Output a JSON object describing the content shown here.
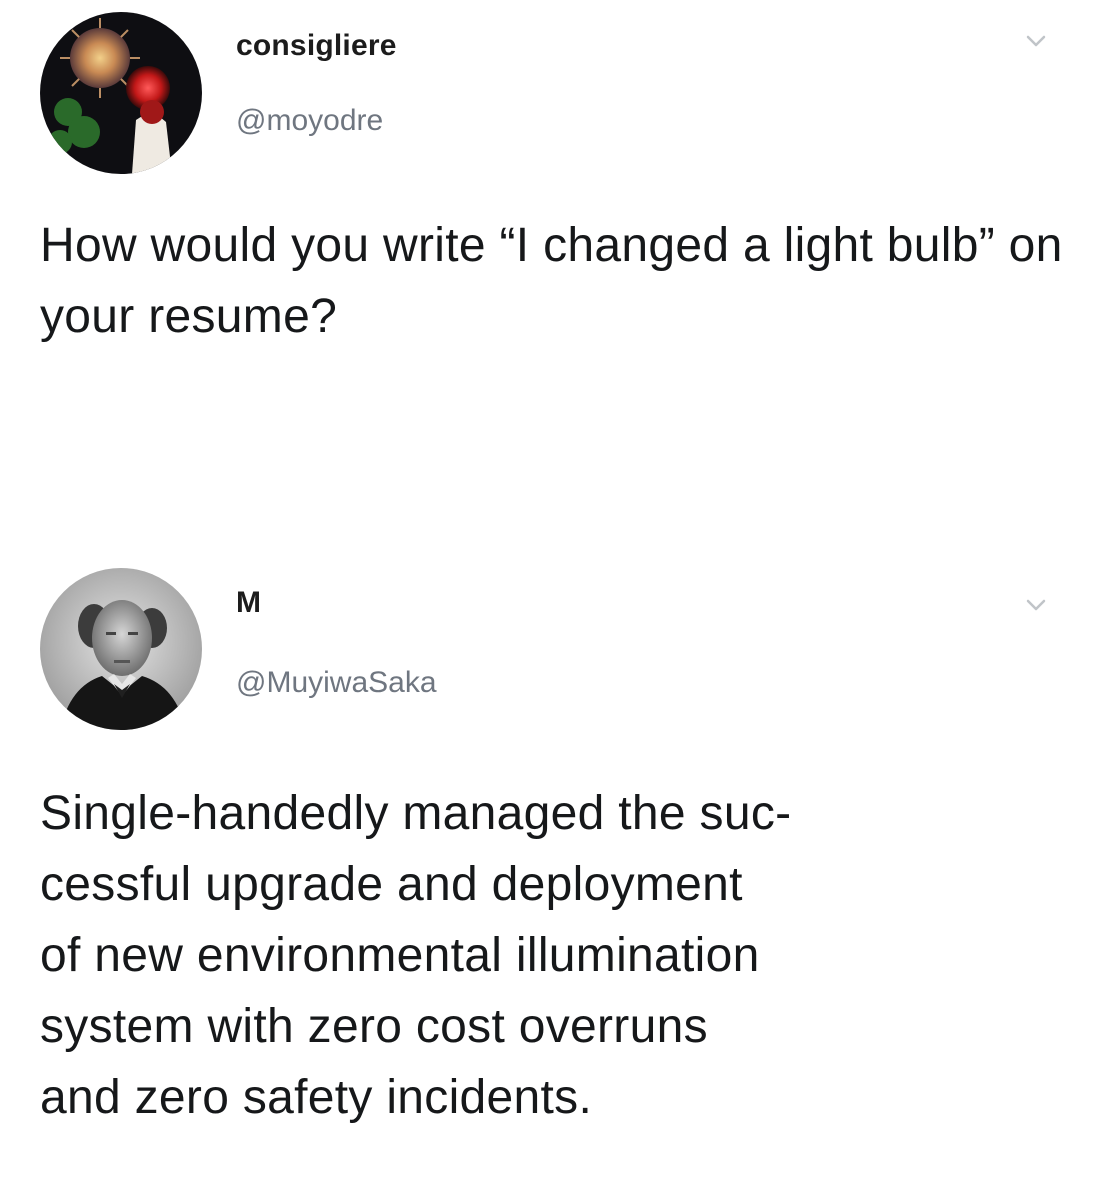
{
  "tweets": [
    {
      "display_name": "consigliere",
      "handle": "@moyodre",
      "text": "How would you write “I changed a light bulb” on your resume?",
      "avatar_icon": "avatar-fireworks-icon",
      "menu_icon": "chevron-down-icon"
    },
    {
      "display_name": "M",
      "handle": "@MuyiwaSaka",
      "text": "Single-handedly managed the suc-\ncessful upgrade and deployment\nof new environmental illumination\nsystem with zero cost overruns\nand zero safety incidents.",
      "avatar_icon": "avatar-portrait-icon",
      "menu_icon": "chevron-down-icon"
    }
  ],
  "colors": {
    "background": "#ffffff",
    "text": "#16181a",
    "handle": "#6f7680",
    "chevron": "#c0c4c8"
  }
}
